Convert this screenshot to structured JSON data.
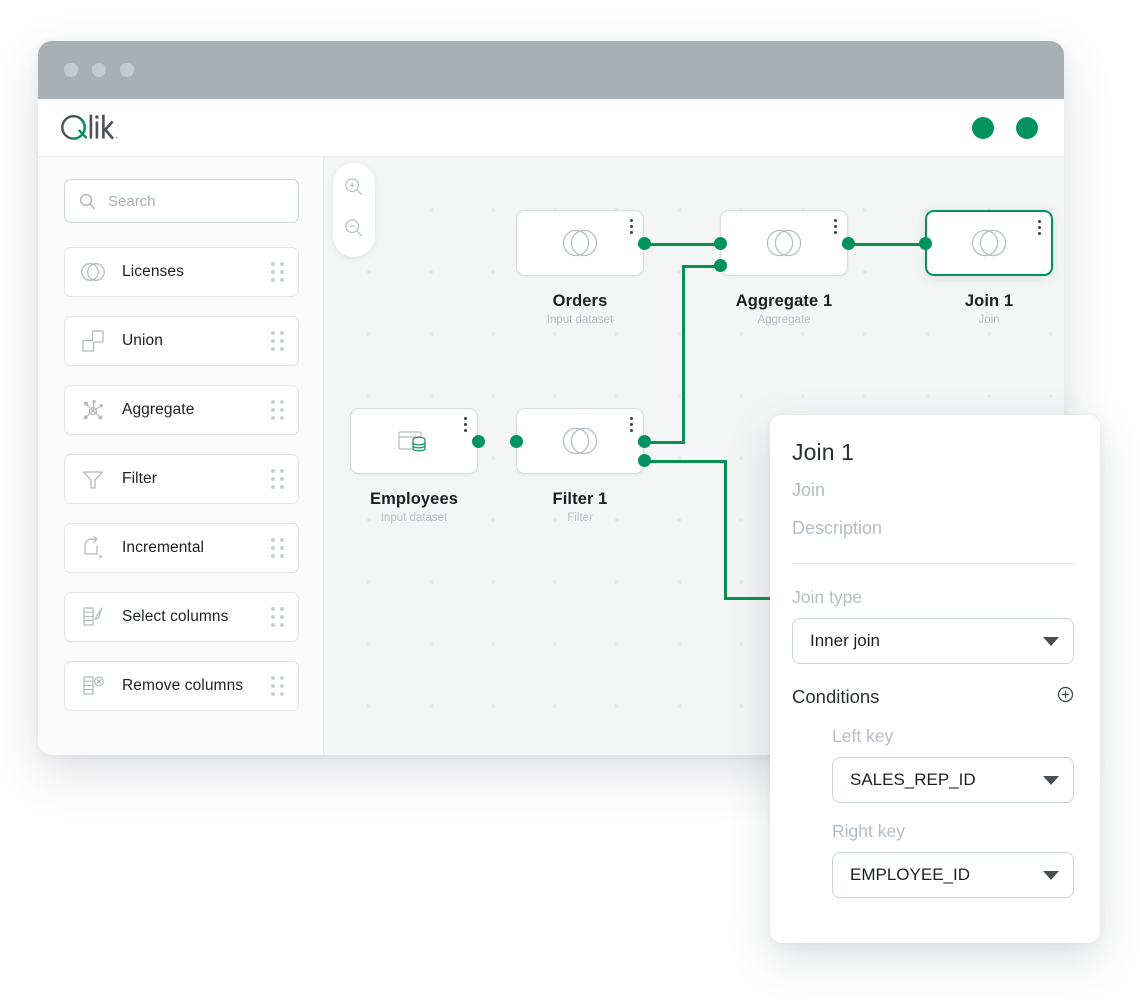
{
  "window": {
    "titlebar_dots": [
      "close-dot",
      "minimize-dot",
      "maximize-dot"
    ],
    "brand": "Qlik",
    "status_dots": [
      "status-dot-1",
      "status-dot-2"
    ],
    "accent_green": "#00935f",
    "titlebar_gray": "#a8b0b4"
  },
  "sidebar": {
    "search": {
      "placeholder": "Search",
      "value": ""
    },
    "items": [
      {
        "label": "Licenses",
        "icon": "venn-circles-icon"
      },
      {
        "label": "Union",
        "icon": "union-shape-icon"
      },
      {
        "label": "Aggregate",
        "icon": "aggregate-nodes-icon"
      },
      {
        "label": "Filter",
        "icon": "funnel-icon"
      },
      {
        "label": "Incremental",
        "icon": "incremental-icon"
      },
      {
        "label": "Select columns",
        "icon": "select-columns-icon"
      },
      {
        "label": "Remove columns",
        "icon": "remove-columns-icon"
      }
    ]
  },
  "canvas": {
    "zoom_controls": [
      {
        "name": "zoom-in-button",
        "icon": "magnifier-plus-icon"
      },
      {
        "name": "zoom-out-button",
        "icon": "magnifier-minus-icon"
      }
    ],
    "nodes": [
      {
        "id": "orders",
        "title": "Orders",
        "subtitle": "Input dataset",
        "icon": "venn-circles-icon",
        "selected": false
      },
      {
        "id": "aggregate1",
        "title": "Aggregate 1",
        "subtitle": "Aggregate",
        "icon": "venn-circles-icon",
        "selected": false
      },
      {
        "id": "join1",
        "title": "Join 1",
        "subtitle": "Join",
        "icon": "venn-circles-icon",
        "selected": true
      },
      {
        "id": "employees",
        "title": "Employees",
        "subtitle": "Input dataset",
        "icon": "database-table-icon",
        "selected": false
      },
      {
        "id": "filter1",
        "title": "Filter 1",
        "subtitle": "Filter",
        "icon": "venn-circles-icon",
        "selected": false
      }
    ]
  },
  "panel": {
    "title": "Join 1",
    "type_label": "Join",
    "description_placeholder": "Description",
    "join_type_label": "Join type",
    "join_type_value": "Inner join",
    "conditions_label": "Conditions",
    "add_condition_icon": "plus-circle-icon",
    "left_key_label": "Left key",
    "left_key_value": "SALES_REP_ID",
    "right_key_label": "Right key",
    "right_key_value": "EMPLOYEE_ID"
  }
}
